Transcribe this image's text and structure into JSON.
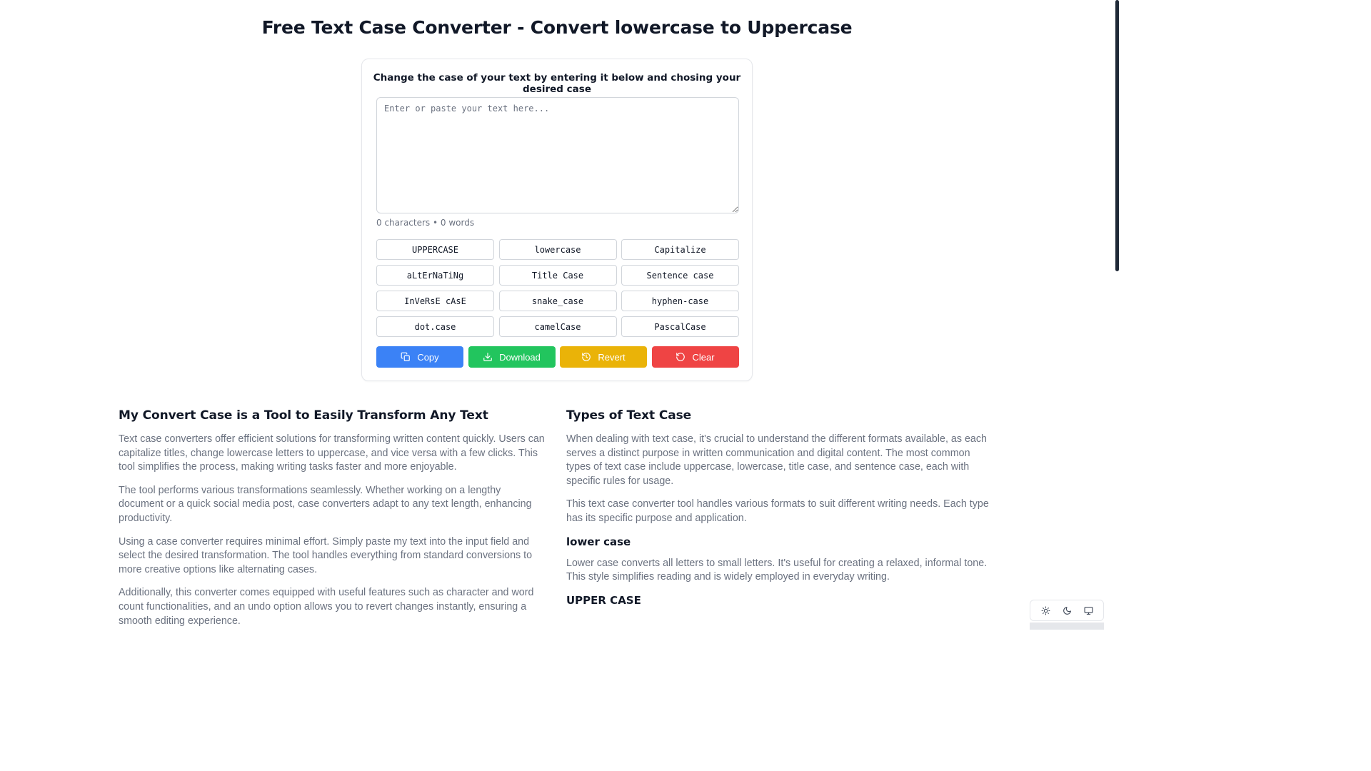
{
  "header": {
    "title": "Free Text Case Converter - Convert lowercase to Uppercase"
  },
  "converter": {
    "subtitle": "Change the case of your text by entering it below and chosing your desired case",
    "input": {
      "placeholder": "Enter or paste your text here...",
      "value": ""
    },
    "counts": "0 characters • 0 words",
    "case_buttons": [
      "UPPERCASE",
      "lowercase",
      "Capitalize",
      "aLtErNaTiNg",
      "Title Case",
      "Sentence case",
      "InVeRsE cAsE",
      "snake_case",
      "hyphen-case",
      "dot.case",
      "camelCase",
      "PascalCase"
    ],
    "actions": {
      "copy": "Copy",
      "download": "Download",
      "revert": "Revert",
      "clear": "Clear"
    }
  },
  "left_section": {
    "heading": "My Convert Case is a Tool to Easily Transform Any Text",
    "paragraphs": [
      "Text case converters offer efficient solutions for transforming written content quickly. Users can capitalize titles, change lowercase letters to uppercase, and vice versa with a few clicks. This tool simplifies the process, making writing tasks faster and more enjoyable.",
      "The tool performs various transformations seamlessly. Whether working on a lengthy document or a quick social media post, case converters adapt to any text length, enhancing productivity.",
      "Using a case converter requires minimal effort. Simply paste my text into the input field and select the desired transformation. The tool handles everything from standard conversions to more creative options like alternating cases.",
      "Additionally, this converter comes equipped with useful features such as character and word count functionalities, and an undo option allows you to revert changes instantly, ensuring a smooth editing experience."
    ]
  },
  "right_section": {
    "heading": "Types of Text Case",
    "paragraphs": [
      "When dealing with text case, it's crucial to understand the different formats available, as each serves a distinct purpose in written communication and digital content. The most common types of text case include uppercase, lowercase, title case, and sentence case, each with specific rules for usage.",
      "This text case converter tool handles various formats to suit different writing needs. Each type has its specific purpose and application."
    ],
    "lower_heading": "lower case",
    "lower_paragraph": "Lower case converts all letters to small letters. It's useful for creating a relaxed, informal tone. This style simplifies reading and is widely employed in everyday writing.",
    "upper_heading": "UPPER CASE"
  },
  "theme_switch": {
    "icons": [
      "sun-icon",
      "moon-icon",
      "monitor-icon"
    ]
  },
  "colors": {
    "copy": "#3b82f6",
    "download": "#22c55e",
    "revert": "#eab308",
    "clear": "#ef4444"
  }
}
